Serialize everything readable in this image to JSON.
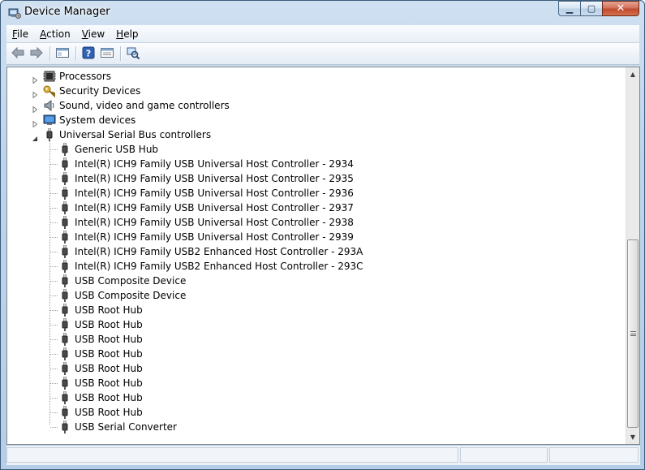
{
  "window": {
    "title": "Device Manager",
    "caption": {
      "minimize": "▁",
      "maximize": "▢",
      "close": "✕"
    }
  },
  "menu": [
    {
      "label": "File",
      "mnemonic": "F"
    },
    {
      "label": "Action",
      "mnemonic": "A"
    },
    {
      "label": "View",
      "mnemonic": "V"
    },
    {
      "label": "Help",
      "mnemonic": "H"
    }
  ],
  "toolbar": [
    {
      "name": "back-icon"
    },
    {
      "name": "forward-icon"
    },
    {
      "name": "show-hide-console-tree-icon"
    },
    {
      "name": "help-icon"
    },
    {
      "name": "properties-icon"
    },
    {
      "name": "scan-hardware-changes-icon"
    }
  ],
  "tree": {
    "categories": [
      {
        "label": "Processors",
        "icon": "processor-icon",
        "expanded": false
      },
      {
        "label": "Security Devices",
        "icon": "key-icon",
        "expanded": false
      },
      {
        "label": "Sound, video and game controllers",
        "icon": "speaker-icon",
        "expanded": false
      },
      {
        "label": "System devices",
        "icon": "monitor-icon",
        "expanded": false
      },
      {
        "label": "Universal Serial Bus controllers",
        "icon": "usb-plug-icon",
        "expanded": true
      }
    ],
    "usb_children": [
      "Generic USB Hub",
      "Intel(R) ICH9 Family USB Universal Host Controller - 2934",
      "Intel(R) ICH9 Family USB Universal Host Controller - 2935",
      "Intel(R) ICH9 Family USB Universal Host Controller - 2936",
      "Intel(R) ICH9 Family USB Universal Host Controller - 2937",
      "Intel(R) ICH9 Family USB Universal Host Controller - 2938",
      "Intel(R) ICH9 Family USB Universal Host Controller - 2939",
      "Intel(R) ICH9 Family USB2 Enhanced Host Controller - 293A",
      "Intel(R) ICH9 Family USB2 Enhanced Host Controller - 293C",
      "USB Composite Device",
      "USB Composite Device",
      "USB Root Hub",
      "USB Root Hub",
      "USB Root Hub",
      "USB Root Hub",
      "USB Root Hub",
      "USB Root Hub",
      "USB Root Hub",
      "USB Root Hub",
      "USB Serial Converter"
    ]
  },
  "scrollbar": {
    "up": "▲",
    "down": "▼"
  },
  "colors": {
    "title_gradient_top": "#cfe0f1",
    "close_button": "#c24a2f",
    "tree_text": "#000000"
  }
}
